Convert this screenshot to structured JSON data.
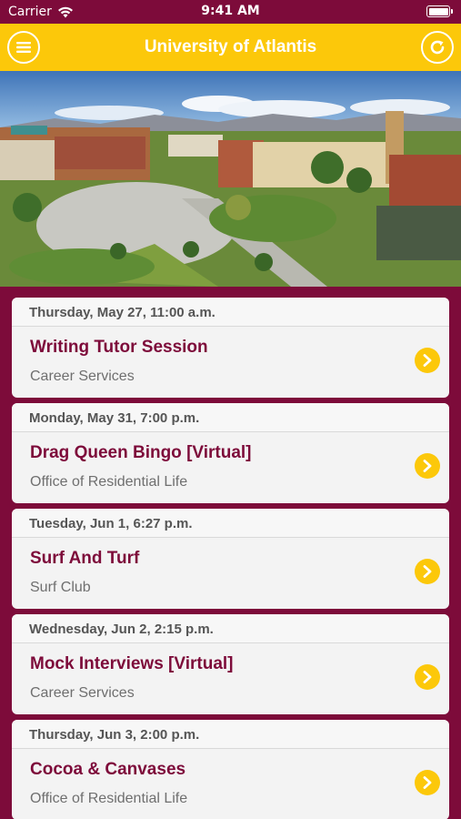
{
  "status": {
    "carrier": "Carrier",
    "time": "9:41 AM"
  },
  "header": {
    "title": "University of Atlantis"
  },
  "hero": {
    "alt": "campus-photo"
  },
  "events": [
    {
      "date": "Thursday, May 27, 11:00 a.m.",
      "title": "Writing Tutor Session",
      "org": "Career Services"
    },
    {
      "date": "Monday, May 31, 7:00 p.m.",
      "title": "Drag Queen Bingo [Virtual]",
      "org": "Office of Residential Life"
    },
    {
      "date": "Tuesday, Jun 1, 6:27 p.m.",
      "title": "Surf And Turf",
      "org": "Surf Club"
    },
    {
      "date": "Wednesday, Jun 2, 2:15 p.m.",
      "title": "Mock Interviews [Virtual]",
      "org": "Career Services"
    },
    {
      "date": "Thursday, Jun 3, 2:00 p.m.",
      "title": "Cocoa & Canvases",
      "org": "Office of Residential Life"
    }
  ],
  "colors": {
    "primary": "#7d0b3a",
    "accent": "#fcc80a"
  }
}
